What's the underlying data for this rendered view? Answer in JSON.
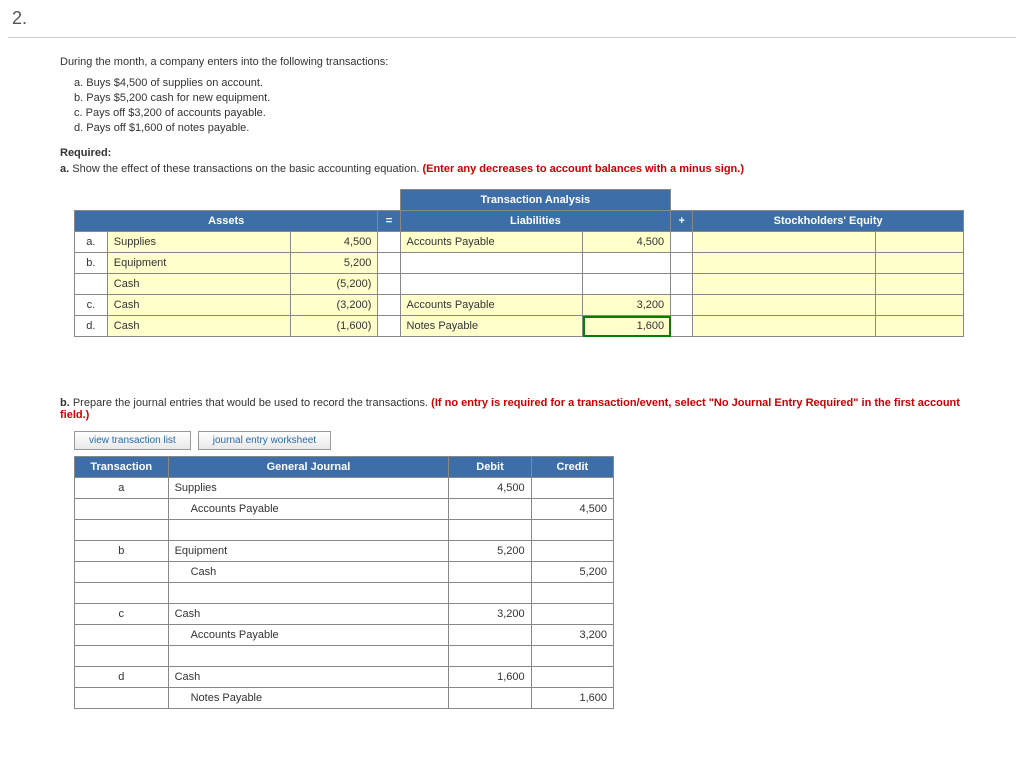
{
  "page_num": "2.",
  "intro": "During the month, a company enters into the following transactions:",
  "transactions": [
    "a.  Buys $4,500 of supplies on account.",
    "b.  Pays $5,200 cash for new equipment.",
    "c.  Pays off $3,200 of accounts payable.",
    "d.  Pays off $1,600 of notes payable."
  ],
  "required_label": "Required:",
  "req_a_prefix": "a.",
  "req_a_text": "Show the effect of these transactions on the basic accounting equation. ",
  "req_a_red": "(Enter any decreases to account balances with a minus sign.)",
  "analysis": {
    "title": "Transaction Analysis",
    "headers": {
      "assets": "Assets",
      "eq": "=",
      "liab": "Liabilities",
      "plus": "+",
      "se": "Stockholders' Equity"
    },
    "rows": [
      {
        "letter": "a.",
        "asset_acct": "Supplies",
        "asset_amt": "4,500",
        "liab_acct": "Accounts Payable",
        "liab_amt": "4,500",
        "green": false
      },
      {
        "letter": "b.",
        "asset_acct": "Equipment",
        "asset_amt": "5,200",
        "liab_acct": "",
        "liab_amt": "",
        "green": false
      },
      {
        "letter": "",
        "asset_acct": "Cash",
        "asset_amt": "(5,200)",
        "liab_acct": "",
        "liab_amt": "",
        "green": false
      },
      {
        "letter": "c.",
        "asset_acct": "Cash",
        "asset_amt": "(3,200)",
        "liab_acct": "Accounts Payable",
        "liab_amt": "3,200",
        "green": false
      },
      {
        "letter": "d.",
        "asset_acct": "Cash",
        "asset_amt": "(1,600)",
        "liab_acct": "Notes Payable",
        "liab_amt": "1,600",
        "green": true
      }
    ]
  },
  "req_b_prefix": "b.",
  "req_b_text": "Prepare the journal entries that would be used to record the transactions. ",
  "req_b_red": "(If no entry is required for a transaction/event, select \"No Journal Entry Required\" in the first account field.)",
  "tabs": {
    "view_list": "view transaction list",
    "worksheet": "journal entry worksheet"
  },
  "journal": {
    "headers": {
      "txn": "Transaction",
      "gj": "General Journal",
      "debit": "Debit",
      "credit": "Credit"
    },
    "rows": [
      {
        "txn": "a",
        "acct": "Supplies",
        "indent": false,
        "debit": "4,500",
        "credit": ""
      },
      {
        "txn": "",
        "acct": "Accounts Payable",
        "indent": true,
        "debit": "",
        "credit": "4,500"
      },
      {
        "txn": "",
        "acct": "",
        "indent": false,
        "debit": "",
        "credit": ""
      },
      {
        "txn": "b",
        "acct": "Equipment",
        "indent": false,
        "debit": "5,200",
        "credit": ""
      },
      {
        "txn": "",
        "acct": "Cash",
        "indent": true,
        "debit": "",
        "credit": "5,200"
      },
      {
        "txn": "",
        "acct": "",
        "indent": false,
        "debit": "",
        "credit": ""
      },
      {
        "txn": "c",
        "acct": "Cash",
        "indent": false,
        "debit": "3,200",
        "credit": ""
      },
      {
        "txn": "",
        "acct": "Accounts Payable",
        "indent": true,
        "debit": "",
        "credit": "3,200"
      },
      {
        "txn": "",
        "acct": "",
        "indent": false,
        "debit": "",
        "credit": ""
      },
      {
        "txn": "d",
        "acct": "Cash",
        "indent": false,
        "debit": "1,600",
        "credit": ""
      },
      {
        "txn": "",
        "acct": "Notes Payable",
        "indent": true,
        "debit": "",
        "credit": "1,600"
      }
    ]
  }
}
